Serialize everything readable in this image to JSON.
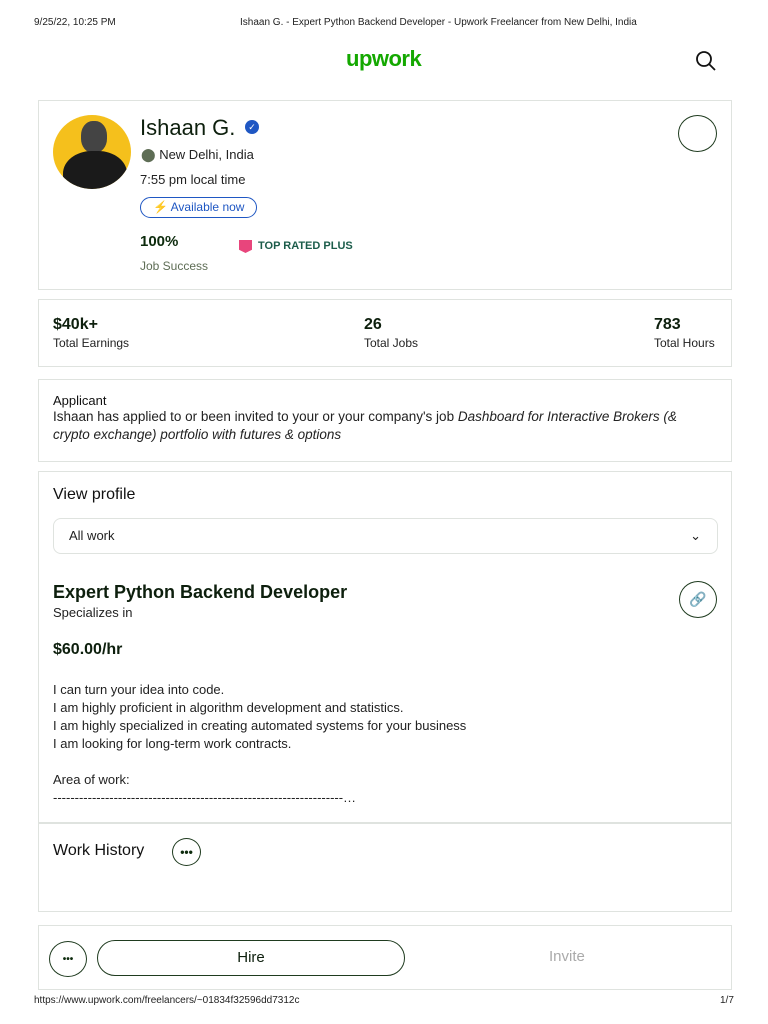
{
  "print_header": {
    "datetime": "9/25/22, 10:25 PM",
    "title": "Ishaan G. - Expert Python Backend Developer - Upwork Freelancer from New Delhi, India"
  },
  "brand": {
    "logo": "upwork",
    "color": "#14a800"
  },
  "profile": {
    "name": "Ishaan G.",
    "location": "New Delhi, India",
    "local_time": "7:55 pm local time",
    "availability": "Available now",
    "job_success": "100%",
    "job_success_label": "Job Success",
    "badge": "TOP RATED PLUS"
  },
  "stats": [
    {
      "value": "$40k+",
      "label": "Total Earnings"
    },
    {
      "value": "26",
      "label": "Total Jobs"
    },
    {
      "value": "783",
      "label": "Total Hours"
    }
  ],
  "applicant": {
    "heading": "Applicant",
    "text": "Ishaan has applied to or been invited to your or your company's job ",
    "job": "Dashboard for Interactive Brokers (& crypto exchange) portfolio with futures & options"
  },
  "view_profile": {
    "heading": "View profile",
    "select_value": "All work"
  },
  "specialization": {
    "title": "Expert Python Backend Developer",
    "subtitle": "Specializes in",
    "rate": "$60.00/hr",
    "lines": [
      "I can turn your idea into code.",
      "I am highly proficient in algorithm development and statistics.",
      "I am highly specialized in creating automated systems for your business",
      "I am looking for long-term work contracts."
    ],
    "area_label": "Area of work:",
    "divider": "-------------------------------------------------------------------…"
  },
  "work_history": {
    "heading": "Work History"
  },
  "actions": {
    "hire": "Hire",
    "invite": "Invite"
  },
  "print_footer": {
    "url": "https://www.upwork.com/freelancers/~01834f32596dd7312c",
    "page": "1/7"
  }
}
